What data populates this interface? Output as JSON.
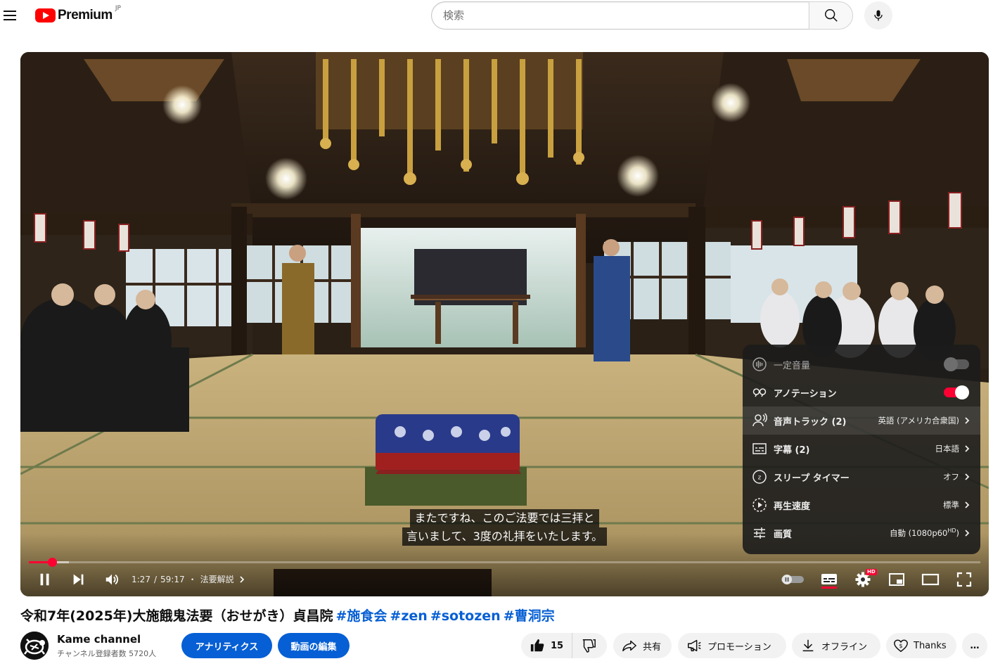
{
  "masthead": {
    "logo_text": "Premium",
    "country_code": "JP",
    "search_placeholder": "検索"
  },
  "player": {
    "subtitles": [
      "またですね、このご法要では三拝と",
      "言いまして、3度の礼拝をいたします。"
    ],
    "time_current": "1:27",
    "time_separator": "/",
    "time_total": "59:17",
    "chapter_separator": "・",
    "chapter": "法要解説",
    "progress_fraction": 0.0245,
    "buffer_fraction": 0.042,
    "settings_badge": "HD",
    "settings_menu": [
      {
        "label": "一定音量",
        "control": "toggle",
        "enabled": false,
        "dim": true,
        "icon": "stable-volume-icon"
      },
      {
        "label": "アノテーション",
        "control": "toggle",
        "enabled": true,
        "dim": false,
        "icon": "annotations-icon"
      },
      {
        "label": "音声トラック (2)",
        "value": "英語 (アメリカ合衆国)",
        "icon": "audio-track-icon",
        "hover": true
      },
      {
        "label": "字幕 (2)",
        "value": "日本語",
        "icon": "subtitles-icon"
      },
      {
        "label": "スリープ タイマー",
        "value": "オフ",
        "icon": "sleep-timer-icon"
      },
      {
        "label": "再生速度",
        "value": "標準",
        "icon": "playback-speed-icon"
      },
      {
        "label": "画質",
        "value": "自動 (1080p60",
        "value_sup": "HD",
        "value_suffix": ")",
        "icon": "quality-icon"
      }
    ]
  },
  "video": {
    "title": "令和7年(2025年)大施餓鬼法要（おせがき）貞昌院",
    "hashtags": [
      "#施食会",
      "#zen",
      "#sotozen",
      "#曹洞宗"
    ]
  },
  "owner": {
    "channel_name": "Kame channel",
    "subscriber_count": "チャンネル登録者数 5720人",
    "analytics_label": "アナリティクス",
    "edit_label": "動画の編集"
  },
  "actions": {
    "like_count": "15",
    "share_label": "共有",
    "promote_label": "プロモーション",
    "offline_label": "オフライン",
    "thanks_label": "Thanks",
    "more_label": "…"
  },
  "colors": {
    "youtube_red": "#ff0000",
    "progress_red": "#ff0033",
    "link_blue": "#065fd4",
    "pill_gray": "#f2f2f2"
  }
}
